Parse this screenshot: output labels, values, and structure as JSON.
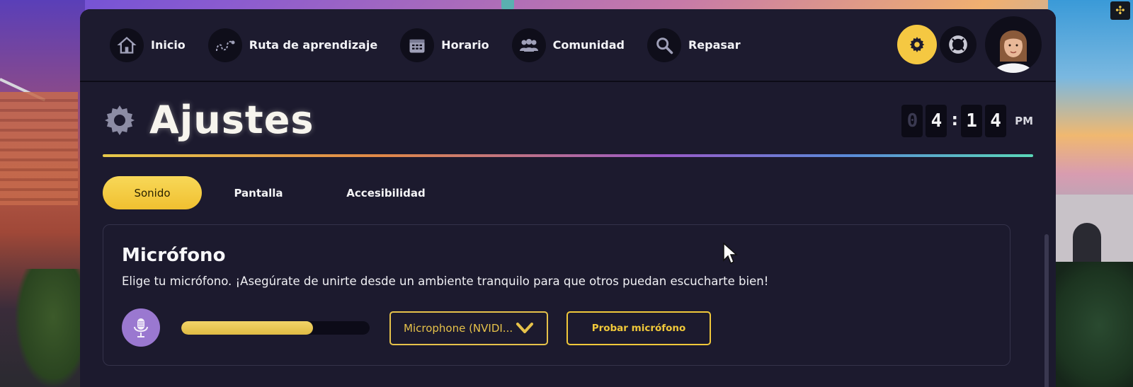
{
  "nav": {
    "items": [
      {
        "label": "Inicio",
        "icon": "home-icon"
      },
      {
        "label": "Ruta de aprendizaje",
        "icon": "route-icon"
      },
      {
        "label": "Horario",
        "icon": "calendar-icon"
      },
      {
        "label": "Comunidad",
        "icon": "community-icon"
      },
      {
        "label": "Repasar",
        "icon": "magnifier-icon"
      }
    ],
    "settings_icon": "gear-icon",
    "help_icon": "lifebuoy-icon",
    "accent_color": "#f5c842"
  },
  "header": {
    "title": "Ajustes",
    "clock": {
      "digits": [
        "0",
        "4",
        "1",
        "4"
      ],
      "separator": ":",
      "period": "PM"
    }
  },
  "tabs": [
    {
      "label": "Sonido",
      "active": true
    },
    {
      "label": "Pantalla",
      "active": false
    },
    {
      "label": "Accesibilidad",
      "active": false
    }
  ],
  "microphone": {
    "title": "Micrófono",
    "description": "Elige tu micrófono. ¡Asegúrate de unirte desde un ambiente tranquilo para que otros puedan escucharte bien!",
    "level_fraction": 0.7,
    "selected_device": "Microphone (NVIDI...",
    "test_button": "Probar micrófono"
  }
}
